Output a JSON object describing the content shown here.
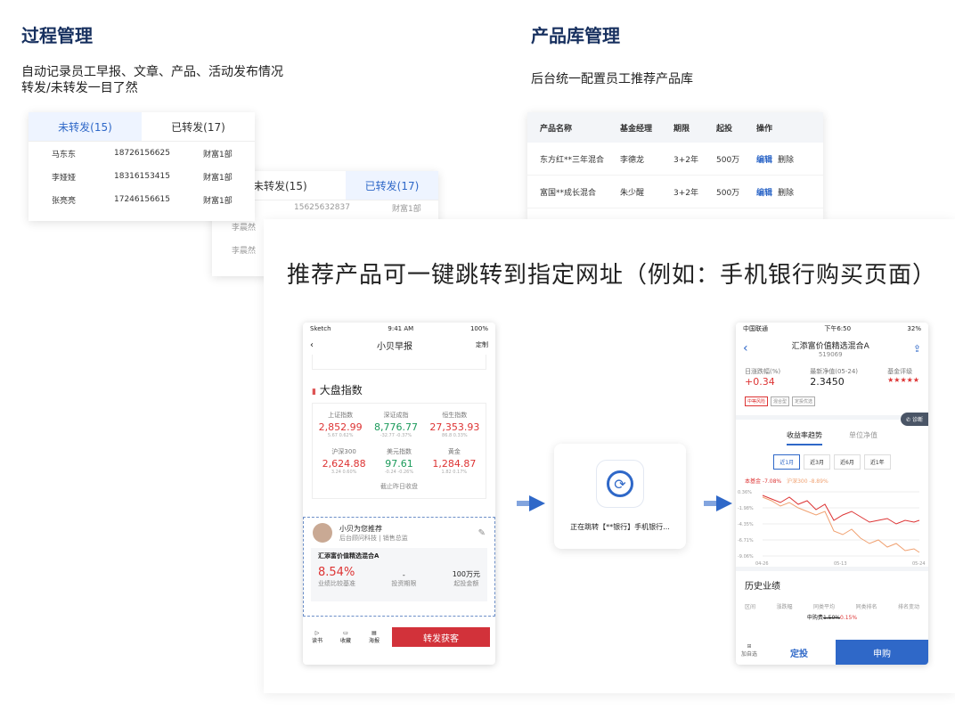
{
  "process": {
    "title": "过程管理",
    "desc1": "自动记录员工早报、文章、产品、活动发布情况",
    "desc2": "转发/未转发一目了然",
    "card1": {
      "tab_active": "未转发(15)",
      "tab_other": "已转发(17)",
      "rows": [
        {
          "name": "马东东",
          "phone": "18726156625",
          "dept": "财富1部"
        },
        {
          "name": "李娅娅",
          "phone": "18316153415",
          "dept": "财富1部"
        },
        {
          "name": "张亮亮",
          "phone": "17246156615",
          "dept": "财富1部"
        }
      ]
    },
    "card2": {
      "tab_other": "未转发(15)",
      "tab_active": "已转发(17)",
      "partial_phone": "15625632837",
      "partial_dept": "财富1部",
      "names": [
        "李晨然",
        "李晨然"
      ]
    }
  },
  "product": {
    "title": "产品库管理",
    "desc": "后台统一配置员工推荐产品库",
    "headers": [
      "产品名称",
      "基金经理",
      "期限",
      "起投",
      "操作"
    ],
    "rows": [
      {
        "name": "东方红**三年混合",
        "manager": "李德龙",
        "term": "3+2年",
        "min": "500万",
        "edit": "编辑",
        "del": "删除"
      },
      {
        "name": "富国**成长混合",
        "manager": "朱少醒",
        "term": "3+2年",
        "min": "500万",
        "edit": "编辑",
        "del": "删除"
      }
    ]
  },
  "headline": "推荐产品可一键跳转到指定网址（例如：手机银行购买页面）",
  "phone1": {
    "status_left": "Sketch",
    "status_time": "9:41 AM",
    "status_right": "100%",
    "nav_title": "小贝早报",
    "nav_right": "定制",
    "section": "大盘指数",
    "indices_row1": [
      {
        "name": "上证指数",
        "value": "2,852.99",
        "chg": "5.67  0.62%",
        "color": "red"
      },
      {
        "name": "深证成指",
        "value": "8,776.77",
        "chg": "-32.77  -0.37%",
        "color": "green"
      },
      {
        "name": "恒生指数",
        "value": "27,353.93",
        "chg": "86.8  0.33%",
        "color": "red"
      }
    ],
    "indices_row2": [
      {
        "name": "沪深300",
        "value": "2,624.88",
        "chg": "3.24  0.60%",
        "color": "red"
      },
      {
        "name": "美元指数",
        "value": "97.61",
        "chg": "-0.24  -0.26%",
        "color": "green"
      },
      {
        "name": "黄金",
        "value": "1,284.87",
        "chg": "1.82  0.17%",
        "color": "red"
      }
    ],
    "more": "截止昨日收盘",
    "rec_title": "小贝为您推荐",
    "rec_sub": "后台顾问科技 | 销售总监",
    "fund_name": "汇添富价值精选混合A",
    "stat1_value": "8.54%",
    "stat1_label": "业绩比较基准",
    "stat2_value": "-",
    "stat2_label": "投资期限",
    "stat3_value": "100万元",
    "stat3_label": "起投金额",
    "tool1": "读书",
    "tool2": "收藏",
    "tool3": "海报",
    "cta": "转发获客"
  },
  "redirect": {
    "text": "正在跳转【**银行】手机银行..."
  },
  "phone2": {
    "status_left": "中国联通",
    "status_time": "下午6:50",
    "status_right": "32%",
    "fund_name": "汇添富价值精选混合A",
    "fund_code": "519069",
    "k1_label": "日涨跌幅(%)",
    "k1_value": "+0.34",
    "k2_label": "最新净值(05-24)",
    "k2_value": "2.3450",
    "k3_label": "基金评级",
    "k3_value": "★★★★★",
    "tags": [
      "中等风险",
      "混合型",
      "定投优选"
    ],
    "diag": "诊断",
    "tab_active": "收益率趋势",
    "tab_other": "单位净值",
    "ranges": [
      "近1月",
      "近3月",
      "近6月",
      "近1年"
    ],
    "legend1": "本基金 -7.08%",
    "legend2": "沪深300 -8.89%",
    "y_ticks": [
      "0.36%",
      "-1.98%",
      "-4.35%",
      "-6.71%",
      "-9.06%"
    ],
    "x_ticks": [
      "04-26",
      "05-13",
      "05-24"
    ],
    "history": "历史业绩",
    "history_cols": [
      "区间",
      "涨跌幅",
      "同类平均",
      "同类排名",
      "排名变动"
    ],
    "fee_label": "申购费",
    "fee_old": "1.50%",
    "fee_new": "0.15%",
    "btn_fav": "加自选",
    "btn_fixed": "定投",
    "btn_buy": "申购",
    "colors": {
      "primary": "#2f68c8",
      "fund_line": "#d33",
      "index_line": "#f0a070"
    }
  }
}
